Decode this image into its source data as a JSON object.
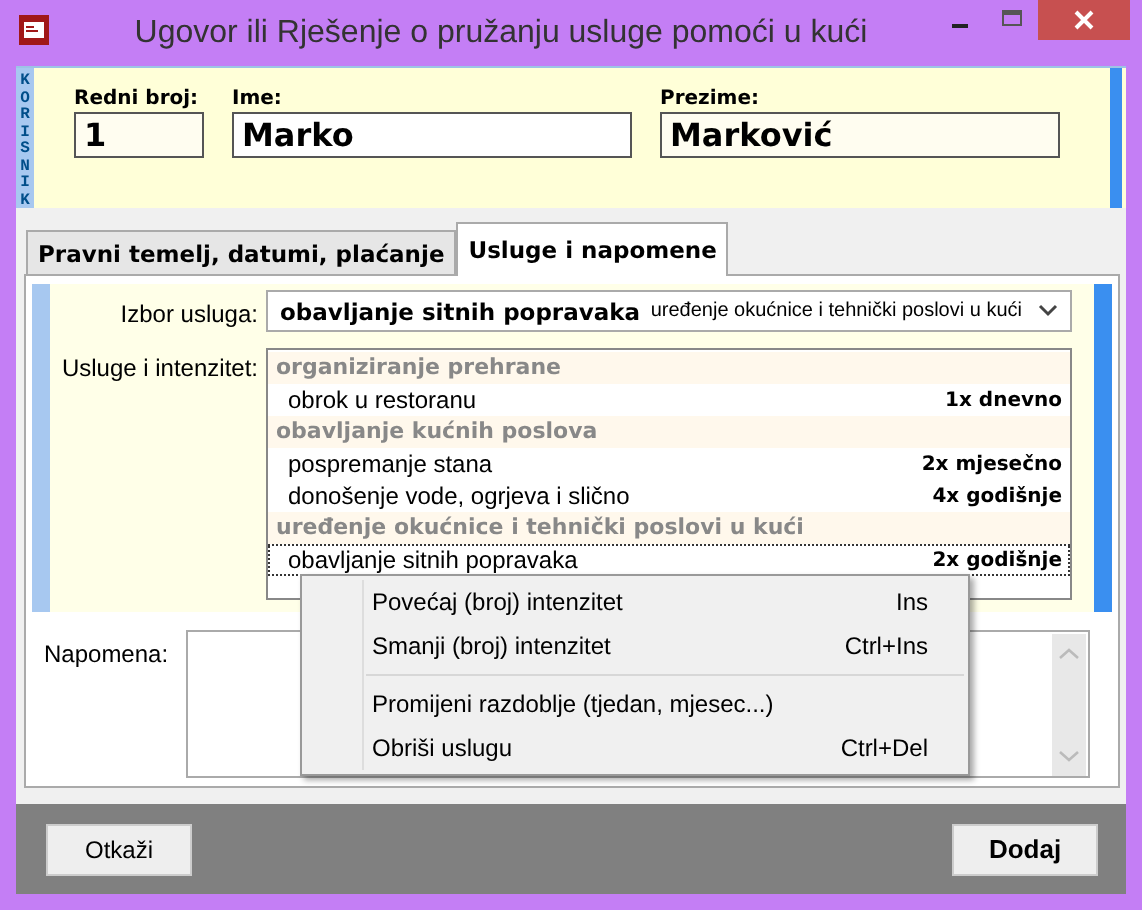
{
  "window": {
    "title": "Ugovor ili Rješenje o pružanju usluge pomoći u kući"
  },
  "header": {
    "side_label": "KORISNIK",
    "fields": [
      {
        "label": "Redni broj:",
        "value": "1"
      },
      {
        "label": "Ime:",
        "value": "Marko"
      },
      {
        "label": "Prezime:",
        "value": "Marković"
      }
    ]
  },
  "tabs": [
    {
      "label": "Pravni temelj, datumi, plaćanje",
      "selected": false
    },
    {
      "label": "Usluge i napomene",
      "selected": true
    }
  ],
  "service_select": {
    "label": "Izbor usluga:",
    "value": "obavljanje sitnih popravaka",
    "category": "uređenje okućnice i tehnički poslovi u kući"
  },
  "services": {
    "label": "Usluge i intenzitet:",
    "groups": [
      {
        "name": "organiziranje prehrane",
        "items": [
          {
            "name": "obrok u restoranu",
            "intensity": "1x dnevno",
            "selected": false
          }
        ]
      },
      {
        "name": "obavljanje kućnih poslova",
        "items": [
          {
            "name": "pospremanje stana",
            "intensity": "2x mjesečno",
            "selected": false
          },
          {
            "name": "donošenje vode, ogrjeva i slično",
            "intensity": "4x godišnje",
            "selected": false
          }
        ]
      },
      {
        "name": "uređenje okućnice i tehnički poslovi u kući",
        "items": [
          {
            "name": "obavljanje sitnih popravaka",
            "intensity": "2x godišnje",
            "selected": true
          }
        ]
      }
    ]
  },
  "note": {
    "label": "Napomena:"
  },
  "context_menu": {
    "sections": [
      [
        {
          "label": "Povećaj (broj) intenzitet",
          "shortcut": "Ins"
        },
        {
          "label": "Smanji (broj) intenzitet",
          "shortcut": "Ctrl+Ins"
        }
      ],
      [
        {
          "label": "Promijeni razdoblje (tjedan, mjesec...)"
        },
        {
          "label": "Obriši uslugu",
          "shortcut": "Ctrl+Del"
        }
      ]
    ]
  },
  "buttons": [
    {
      "label": "Otkaži",
      "kind": "cancel"
    },
    {
      "label": "Dodaj",
      "kind": "default"
    }
  ]
}
